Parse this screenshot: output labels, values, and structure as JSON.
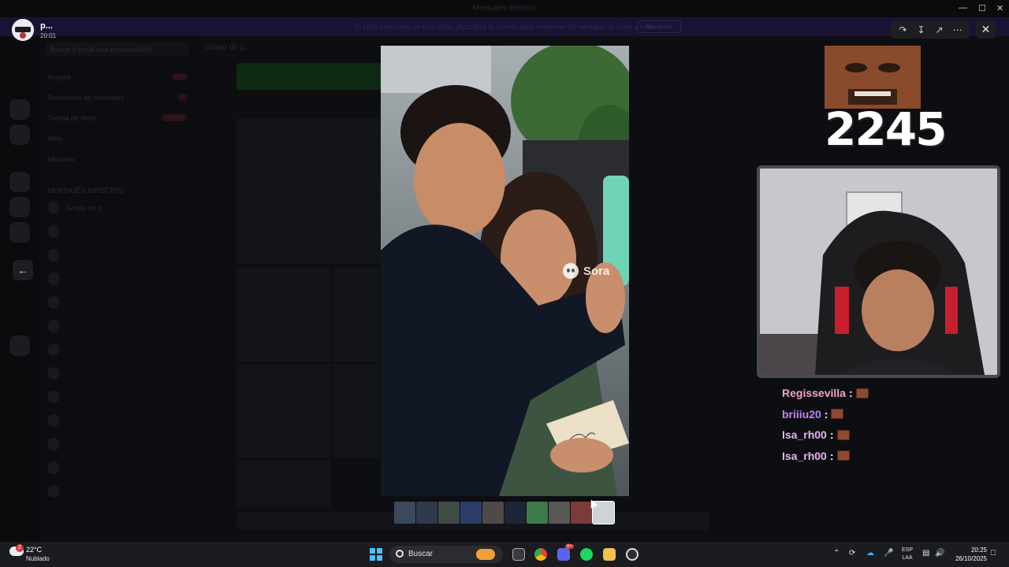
{
  "window": {
    "title": "Mensajes directos"
  },
  "banner": {
    "text": "El Nitro caducado ya está aquí. ¡Actualiza tu cuenta para mantener las ventajas de Nitro y más.",
    "button": "Renovar"
  },
  "sidebar": {
    "search_placeholder": "Busca o inicia una conversación",
    "items": [
      {
        "label": "Amigos",
        "badge": "456"
      },
      {
        "label": "Solicitudes de mensajes",
        "badge": "2"
      },
      {
        "label": "Tienda de Nitro",
        "badge": "NUEVO"
      },
      {
        "label": "Nitro",
        "badge": ""
      },
      {
        "label": "Misiones",
        "badge": ""
      }
    ],
    "section_title": "MENSAJES DIRECTOS",
    "group_label": "Grupo de p..."
  },
  "channel": {
    "title": "Grupo de p..."
  },
  "viewer": {
    "user_name": "p...",
    "time": "20:01",
    "actions": [
      "forward-icon",
      "download-icon",
      "open-external-icon",
      "more-icon"
    ],
    "watermark": "Sora",
    "thumbnail_count": 10
  },
  "overlay": {
    "counter": "2245",
    "chat": [
      {
        "user": "Regissevilla",
        "color": "#f4a4c0"
      },
      {
        "user": "briiiu20",
        "color": "#c084fc"
      },
      {
        "user": "Isa_rh00",
        "color": "#e8b4f0"
      },
      {
        "user": "Isa_rh00",
        "color": "#e8b4f0"
      }
    ],
    "colon": ":"
  },
  "taskbar": {
    "weather_badge": "2",
    "temperature": "22°C",
    "condition": "Nublado",
    "search_label": "Buscar",
    "notification_badge": "9+",
    "lang_top": "ESP",
    "lang_bottom": "LAA",
    "time": "20:25",
    "date": "26/10/2025"
  }
}
